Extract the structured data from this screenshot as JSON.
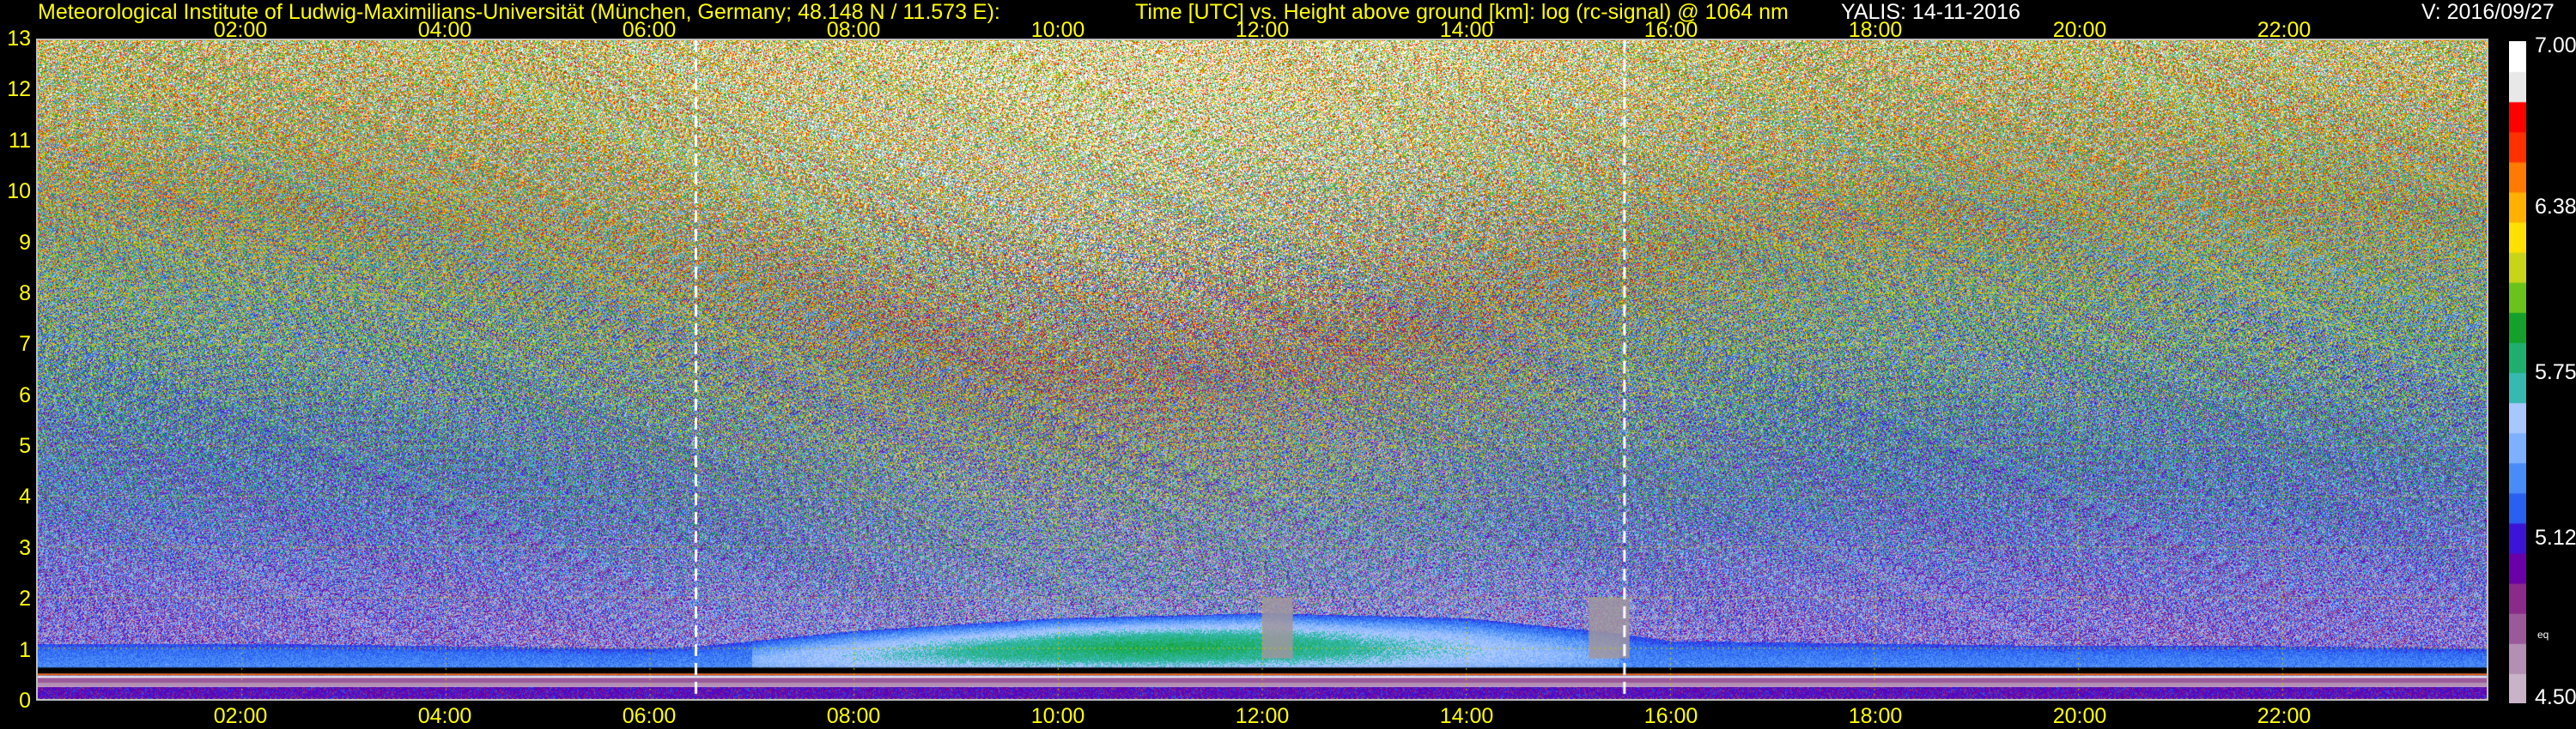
{
  "header": {
    "institute": "Meteorological Institute of Ludwig-Maximilians-Universität (München, Germany; 48.148 N / 11.573 E):",
    "plot_title": "Time [UTC] vs. Height above ground [km]: log (rc-signal) @ 1064 nm",
    "instrument_date": "YALIS: 14-11-2016",
    "version": "V: 2016/09/27"
  },
  "colorbar": {
    "ticks": [
      "7.00",
      "6.38",
      "5.75",
      "5.12",
      "4.50"
    ],
    "unit": "eq",
    "range": [
      4.5,
      7.0
    ],
    "colors": [
      "#c9b3c9",
      "#b48fb4",
      "#9a5a9a",
      "#8a2b8a",
      "#6a00a8",
      "#3c14d6",
      "#2a60f0",
      "#4a8cf7",
      "#7fb0ff",
      "#a9c7ff",
      "#37b8b0",
      "#1fae6e",
      "#14a02a",
      "#6ac21a",
      "#c8d41a",
      "#ffe000",
      "#ffb000",
      "#ff7a00",
      "#ff3000",
      "#ff0000",
      "#e8e8e8",
      "#ffffff"
    ]
  },
  "chart_data": {
    "type": "heatmap",
    "title": "Time [UTC] vs. Height above ground [km]: log (rc-signal) @ 1064 nm",
    "xlabel": "Time [UTC]",
    "ylabel": "Height above ground [km]",
    "x_tick_labels": [
      "02:00",
      "04:00",
      "06:00",
      "08:00",
      "10:00",
      "12:00",
      "14:00",
      "16:00",
      "18:00",
      "20:00",
      "22:00"
    ],
    "x_ticks_hours": [
      2,
      4,
      6,
      8,
      10,
      12,
      14,
      16,
      18,
      20,
      22
    ],
    "xlim_hours": [
      0,
      24
    ],
    "y_ticks": [
      0,
      1,
      2,
      3,
      4,
      5,
      6,
      7,
      8,
      9,
      10,
      11,
      12,
      13
    ],
    "y_tick_labels": [
      "0",
      "1",
      "2",
      "3",
      "4",
      "5",
      "6",
      "7",
      "8",
      "9",
      "10",
      "11",
      "12",
      "13"
    ],
    "ylim": [
      0,
      13
    ],
    "color_range": [
      4.5,
      7.0
    ],
    "grid": true,
    "grid_color": "#c8c800",
    "markers_hours": [
      6.45,
      15.55
    ],
    "boundary_layer_top_km": [
      [
        0,
        1.1
      ],
      [
        2,
        1.1
      ],
      [
        4,
        1.05
      ],
      [
        6,
        1.0
      ],
      [
        6.5,
        1.05
      ],
      [
        8,
        1.35
      ],
      [
        10,
        1.6
      ],
      [
        12,
        1.7
      ],
      [
        14,
        1.6
      ],
      [
        15.5,
        1.3
      ],
      [
        16,
        1.15
      ],
      [
        18,
        1.1
      ],
      [
        20,
        1.05
      ],
      [
        22,
        1.05
      ],
      [
        24,
        1.0
      ]
    ],
    "precipitation_hours": [
      [
        12.0,
        12.3
      ],
      [
        15.2,
        15.6
      ]
    ]
  }
}
